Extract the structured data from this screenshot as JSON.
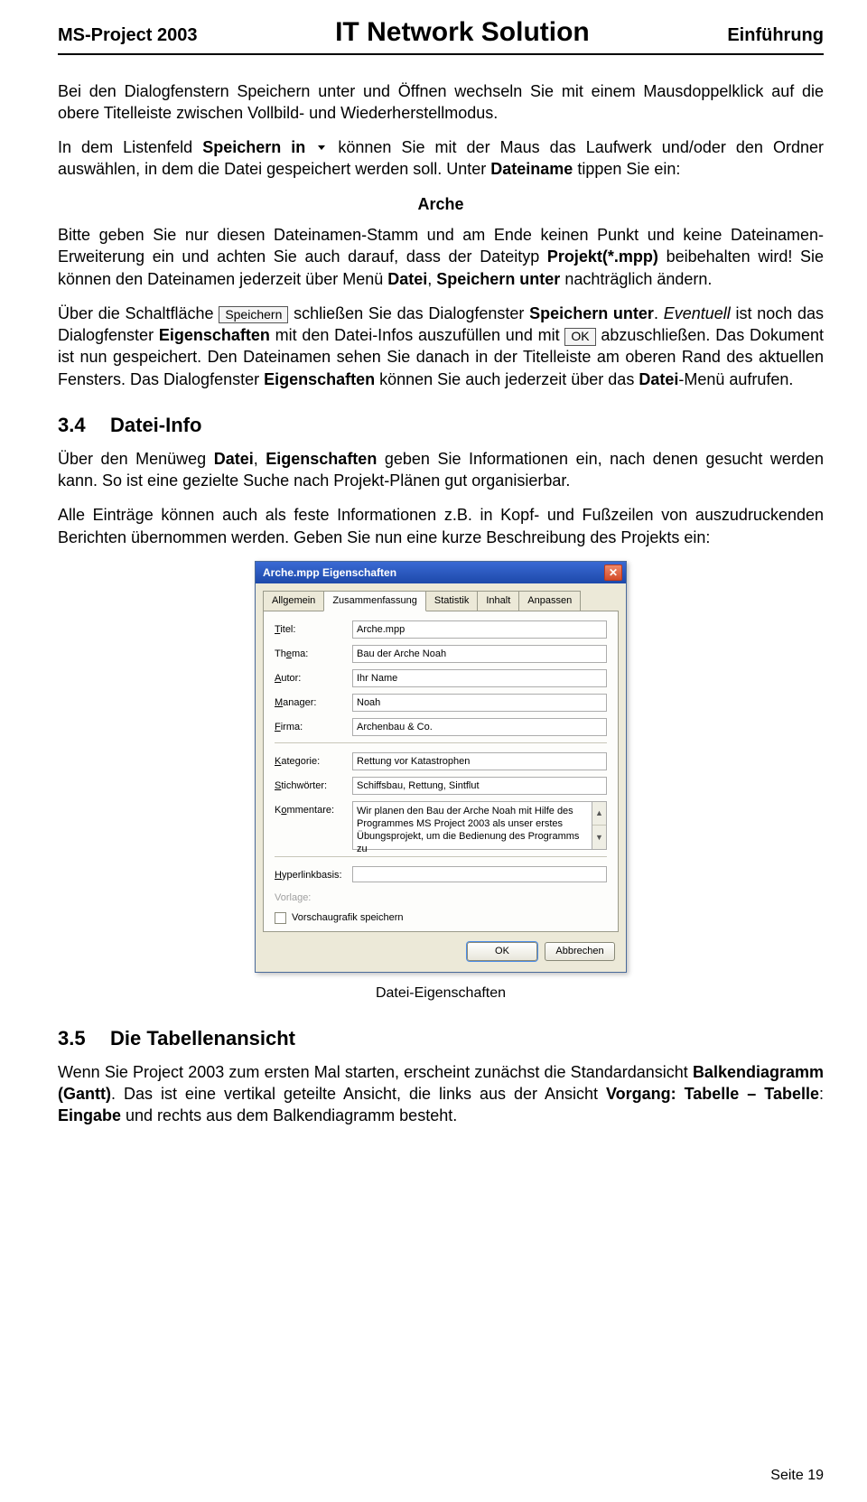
{
  "header": {
    "left": "MS-Project 2003",
    "center": "IT Network Solution",
    "right": "Einführung"
  },
  "p1_a": "Bei den Dialogfenstern Speichern unter und Öffnen wechseln Sie mit einem Mausdoppelklick auf die obere Titelleiste zwischen Vollbild- und Wiederherstellmodus.",
  "p2_a": "In dem Listenfeld ",
  "p2_b": "Speichern in",
  "p2_c": " können Sie mit der Maus das Laufwerk und/oder den Ordner auswählen, in dem die Datei gespeichert werden soll. Unter ",
  "p2_d": "Dateiname",
  "p2_e": " tippen Sie ein:",
  "center_word": "Arche",
  "p3_a": "Bitte geben Sie nur diesen Dateinamen-Stamm und am Ende keinen Punkt und keine Dateinamen-Erweiterung ein und achten Sie auch darauf, dass der Dateityp ",
  "p3_b": "Projekt(*.mpp)",
  "p3_c": " beibehalten wird! Sie können den Dateinamen jederzeit über Menü ",
  "p3_d": "Datei",
  "p3_e": ", ",
  "p3_f": "Speichern unter",
  "p3_g": " nachträglich ändern.",
  "p4_a": "Über die Schaltfläche ",
  "btn_save": "Speichern",
  "p4_b": " schließen Sie das Dialogfenster ",
  "p4_c": "Speichern unter",
  "p4_d": ". ",
  "p4_e": "Eventuell",
  "p4_f": " ist noch das Dialogfenster ",
  "p4_g": "Eigenschaften",
  "p4_h": " mit den Datei-Infos auszufüllen und mit ",
  "btn_ok": "OK",
  "p4_i": " abzuschließen. Das Dokument ist nun gespeichert. Den Dateinamen sehen Sie danach in der Titelleiste am oberen Rand des aktuellen Fensters. Das Dialogfenster ",
  "p4_j": "Eigenschaften",
  "p4_k": " können Sie auch jederzeit über das ",
  "p4_l": "Datei",
  "p4_m": "-Menü aufrufen.",
  "s34": {
    "num": "3.4",
    "title": "Datei-Info"
  },
  "p5_a": "Über den Menüweg ",
  "p5_b": "Datei",
  "p5_c": ", ",
  "p5_d": "Eigenschaften",
  "p5_e": " geben Sie Informationen ein, nach denen gesucht werden kann. So ist eine gezielte Suche nach Projekt-Plänen gut organisierbar.",
  "p6": "Alle Einträge können auch als feste Informationen z.B. in Kopf- und Fußzeilen von auszudruckenden Berichten übernommen werden. Geben Sie nun eine kurze Beschreibung des Projekts ein:",
  "dialog": {
    "title": "Arche.mpp Eigenschaften",
    "tabs": [
      "Allgemein",
      "Zusammenfassung",
      "Statistik",
      "Inhalt",
      "Anpassen"
    ],
    "active_tab": 1,
    "fields": {
      "titel": {
        "label": "Titel:",
        "value": "Arche.mpp"
      },
      "thema": {
        "label": "Thema:",
        "value": "Bau der Arche Noah"
      },
      "autor": {
        "label": "Autor:",
        "value": "Ihr Name"
      },
      "manager": {
        "label": "Manager:",
        "value": "Noah"
      },
      "firma": {
        "label": "Firma:",
        "value": "Archenbau & Co."
      },
      "kategorie": {
        "label": "Kategorie:",
        "value": "Rettung vor Katastrophen"
      },
      "stichwoerter": {
        "label": "Stichwörter:",
        "value": "Schiffsbau, Rettung, Sintflut"
      },
      "kommentare": {
        "label": "Kommentare:",
        "value": "Wir planen den Bau der Arche Noah mit Hilfe des Programmes MS Project 2003 als unser erstes Übungsprojekt, um die Bedienung des Programms zu"
      },
      "hyperlink": {
        "label": "Hyperlinkbasis:",
        "value": ""
      },
      "vorlage": {
        "label": "Vorlage:",
        "value": ""
      }
    },
    "checkbox_label": "Vorschaugrafik speichern",
    "buttons": {
      "ok": "OK",
      "cancel": "Abbrechen"
    }
  },
  "caption": "Datei-Eigenschaften",
  "s35": {
    "num": "3.5",
    "title": "Die Tabellenansicht"
  },
  "p7_a": "Wenn Sie Project 2003 zum ersten Mal starten, erscheint zunächst die Standardansicht ",
  "p7_b": "Balkendiagramm (Gantt)",
  "p7_c": ". Das ist eine vertikal geteilte Ansicht, die links aus der Ansicht ",
  "p7_d": "Vorgang: Tabelle – Tabelle",
  "p7_e": ": ",
  "p7_f": "Eingabe",
  "p7_g": " und rechts aus dem Balkendiagramm besteht.",
  "footer": "Seite 19"
}
